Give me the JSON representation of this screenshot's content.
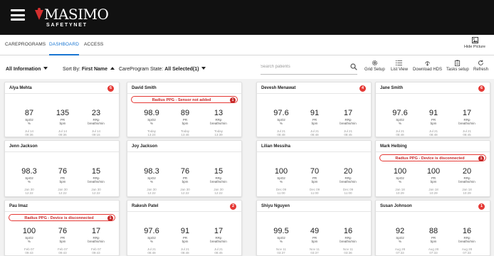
{
  "app": {
    "logo_text": "MASIMO",
    "logo_sub": "SAFETYNET",
    "brand_color": "#d32f2f"
  },
  "nav": {
    "tabs": [
      {
        "label": "CAREPROGRAMS",
        "active": false
      },
      {
        "label": "DASHBOARD",
        "active": true
      },
      {
        "label": "ACCESS",
        "active": false
      }
    ],
    "hide_picture": "Hide Picture"
  },
  "toolbar": {
    "info_filter": "All Information",
    "sort_prefix": "Sort By:",
    "sort_value": "First Name",
    "state_prefix": "CareProgram State:",
    "state_value": "All Selected(1)",
    "search_placeholder": "Search patients",
    "tools": [
      "Grid Setup",
      "List View",
      "Download HDS",
      "Tasks setup",
      "Refresh"
    ]
  },
  "cards": [
    {
      "name": "Alya Mehta",
      "badge": "6",
      "alert": "",
      "alert_badge": "",
      "metrics": [
        {
          "value": "87",
          "label": "SpO2",
          "unit": "%",
          "date": "Jul 14",
          "time": "09:36"
        },
        {
          "value": "135",
          "label": "PR",
          "unit": "bpm",
          "date": "Jul 14",
          "time": "09:36"
        },
        {
          "value": "23",
          "label": "RRp",
          "unit": "breaths/min",
          "date": "Jul 14",
          "time": "09:15"
        }
      ]
    },
    {
      "name": "David Smith",
      "badge": "",
      "alert": "Radius PPG - Sensor not added",
      "alert_badge": "1",
      "metrics": [
        {
          "value": "98.9",
          "label": "SpO2",
          "unit": "%",
          "date": "Today",
          "time": "13:24"
        },
        {
          "value": "89",
          "label": "PR",
          "unit": "bpm",
          "date": "Today",
          "time": "13:46"
        },
        {
          "value": "13",
          "label": "RRp",
          "unit": "breaths/min",
          "date": "Today",
          "time": "13:39"
        }
      ]
    },
    {
      "name": "Devesh Menawat",
      "badge": "4",
      "alert": "",
      "alert_badge": "",
      "metrics": [
        {
          "value": "97.6",
          "label": "SpO2",
          "unit": "%",
          "date": "Jul 21",
          "time": "08:48"
        },
        {
          "value": "91",
          "label": "PR",
          "unit": "bpm",
          "date": "Jul 21",
          "time": "08:48"
        },
        {
          "value": "17",
          "label": "RRp",
          "unit": "breaths/min",
          "date": "Jul 21",
          "time": "08:45"
        }
      ]
    },
    {
      "name": "Jane Smith",
      "badge": "6",
      "alert": "",
      "alert_badge": "",
      "metrics": [
        {
          "value": "97.6",
          "label": "SpO2",
          "unit": "%",
          "date": "Jul 21",
          "time": "08:48"
        },
        {
          "value": "91",
          "label": "PR",
          "unit": "bpm",
          "date": "Jul 21",
          "time": "08:48"
        },
        {
          "value": "17",
          "label": "RRp",
          "unit": "breaths/min",
          "date": "Jul 21",
          "time": "08:45"
        }
      ]
    },
    {
      "name": "Jenn Jackson",
      "badge": "",
      "alert": "",
      "alert_badge": "",
      "metrics": [
        {
          "value": "98.3",
          "label": "SpO2",
          "unit": "%",
          "date": "Jan 30",
          "time": "12:22"
        },
        {
          "value": "76",
          "label": "PR",
          "unit": "bpm",
          "date": "Jan 30",
          "time": "12:22"
        },
        {
          "value": "15",
          "label": "RRp",
          "unit": "breaths/min",
          "date": "Jan 30",
          "time": "12:22"
        }
      ]
    },
    {
      "name": "Joy Jackson",
      "badge": "",
      "alert": "",
      "alert_badge": "",
      "metrics": [
        {
          "value": "98.3",
          "label": "SpO2",
          "unit": "%",
          "date": "Jan 30",
          "time": "12:22"
        },
        {
          "value": "76",
          "label": "PR",
          "unit": "bpm",
          "date": "Jan 30",
          "time": "12:22"
        },
        {
          "value": "15",
          "label": "RRp",
          "unit": "breaths/min",
          "date": "Jan 30",
          "time": "12:22"
        }
      ]
    },
    {
      "name": "Lilian Messiha",
      "badge": "",
      "alert": "",
      "alert_badge": "",
      "metrics": [
        {
          "value": "100",
          "label": "SpO2",
          "unit": "%",
          "date": "Dec 09",
          "time": "11:00"
        },
        {
          "value": "70",
          "label": "PR",
          "unit": "bpm",
          "date": "Dec 09",
          "time": "11:00"
        },
        {
          "value": "20",
          "label": "RRp",
          "unit": "breaths/min",
          "date": "Dec 09",
          "time": "11:00"
        }
      ]
    },
    {
      "name": "Mark Helbing",
      "badge": "",
      "alert": "Radius PPG - Device is disconnected",
      "alert_badge": "1",
      "metrics": [
        {
          "value": "100",
          "label": "SpO2",
          "unit": "%",
          "date": "Jan 18",
          "time": "10:29"
        },
        {
          "value": "100",
          "label": "PR",
          "unit": "bpm",
          "date": "Jan 18",
          "time": "10:29"
        },
        {
          "value": "20",
          "label": "RRp",
          "unit": "breaths/min",
          "date": "Jan 18",
          "time": "10:29"
        }
      ]
    },
    {
      "name": "Pau Imaz",
      "badge": "",
      "alert": "Radius PPG - Device is disconnected",
      "alert_badge": "1",
      "metrics": [
        {
          "value": "100",
          "label": "SpO2",
          "unit": "%",
          "date": "Feb 07",
          "time": "09:43"
        },
        {
          "value": "76",
          "label": "PR",
          "unit": "bpm",
          "date": "Feb 07",
          "time": "09:43"
        },
        {
          "value": "17",
          "label": "RRp",
          "unit": "breaths/min",
          "date": "Feb 07",
          "time": "09:43"
        }
      ]
    },
    {
      "name": "Rakesh Patel",
      "badge": "2",
      "alert": "",
      "alert_badge": "",
      "metrics": [
        {
          "value": "97.6",
          "label": "SpO2",
          "unit": "%",
          "date": "Jul 21",
          "time": "08:48"
        },
        {
          "value": "91",
          "label": "PR",
          "unit": "bpm",
          "date": "Jul 21",
          "time": "08:48"
        },
        {
          "value": "17",
          "label": "RRp",
          "unit": "breaths/min",
          "date": "Jul 21",
          "time": "08:45"
        }
      ]
    },
    {
      "name": "Shiyu Nguyen",
      "badge": "",
      "alert": "",
      "alert_badge": "",
      "metrics": [
        {
          "value": "99.5",
          "label": "SpO2",
          "unit": "%",
          "date": "Nov 11",
          "time": "03:37"
        },
        {
          "value": "49",
          "label": "PR",
          "unit": "bpm",
          "date": "Nov 11",
          "time": "03:37"
        },
        {
          "value": "16",
          "label": "RRp",
          "unit": "breaths/min",
          "date": "Nov 11",
          "time": "03:36"
        }
      ]
    },
    {
      "name": "Susan Johnson",
      "badge": "1",
      "alert": "",
      "alert_badge": "",
      "metrics": [
        {
          "value": "92",
          "label": "SpO2",
          "unit": "%",
          "date": "Aug 28",
          "time": "07:33"
        },
        {
          "value": "88",
          "label": "PR",
          "unit": "bpm",
          "date": "Aug 28",
          "time": "07:33"
        },
        {
          "value": "16",
          "label": "RRp",
          "unit": "breaths/min",
          "date": "Aug 28",
          "time": "07:33"
        }
      ]
    }
  ]
}
